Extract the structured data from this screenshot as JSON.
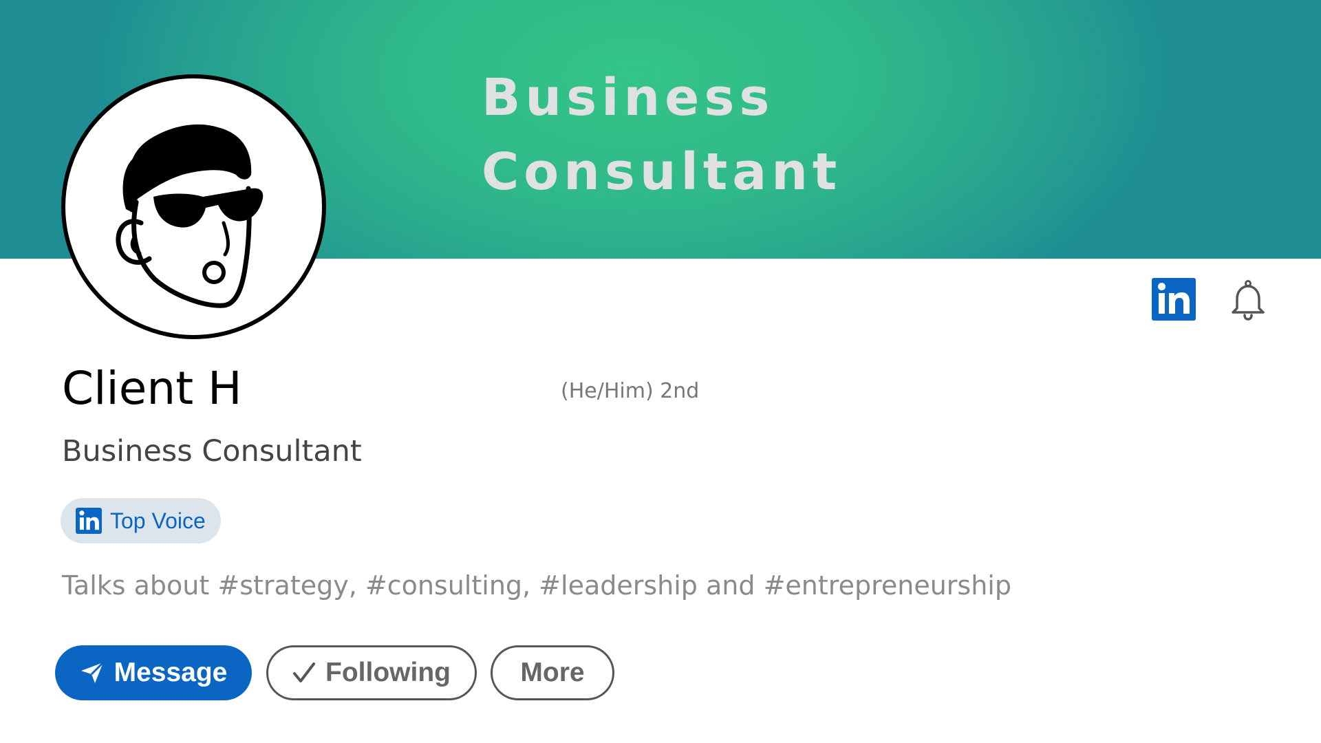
{
  "banner": {
    "title_line1": "Business",
    "title_line2": "Consultant",
    "gradient_colors": [
      "#34c487",
      "#1e8e94"
    ]
  },
  "avatar": {
    "icon": "cartoon-man-sunglasses-avatar"
  },
  "header_icons": {
    "linkedin_icon": "linkedin-logo-icon",
    "notification_icon": "bell-icon"
  },
  "profile": {
    "name": "Client H",
    "pronouns_degree": "(He/Him) 2nd",
    "headline": "Business Consultant",
    "badge_label": "Top Voice",
    "talks_about": "Talks about #strategy, #consulting, #leadership and #entrepreneurship"
  },
  "actions": {
    "message_label": "Message",
    "message_icon": "send-icon",
    "following_label": "Following",
    "following_icon": "checkmark-icon",
    "more_label": "More"
  },
  "colors": {
    "brand_blue": "#0a66c2",
    "badge_bg": "#dde5ec",
    "banner_text": "#dfe1e2"
  }
}
